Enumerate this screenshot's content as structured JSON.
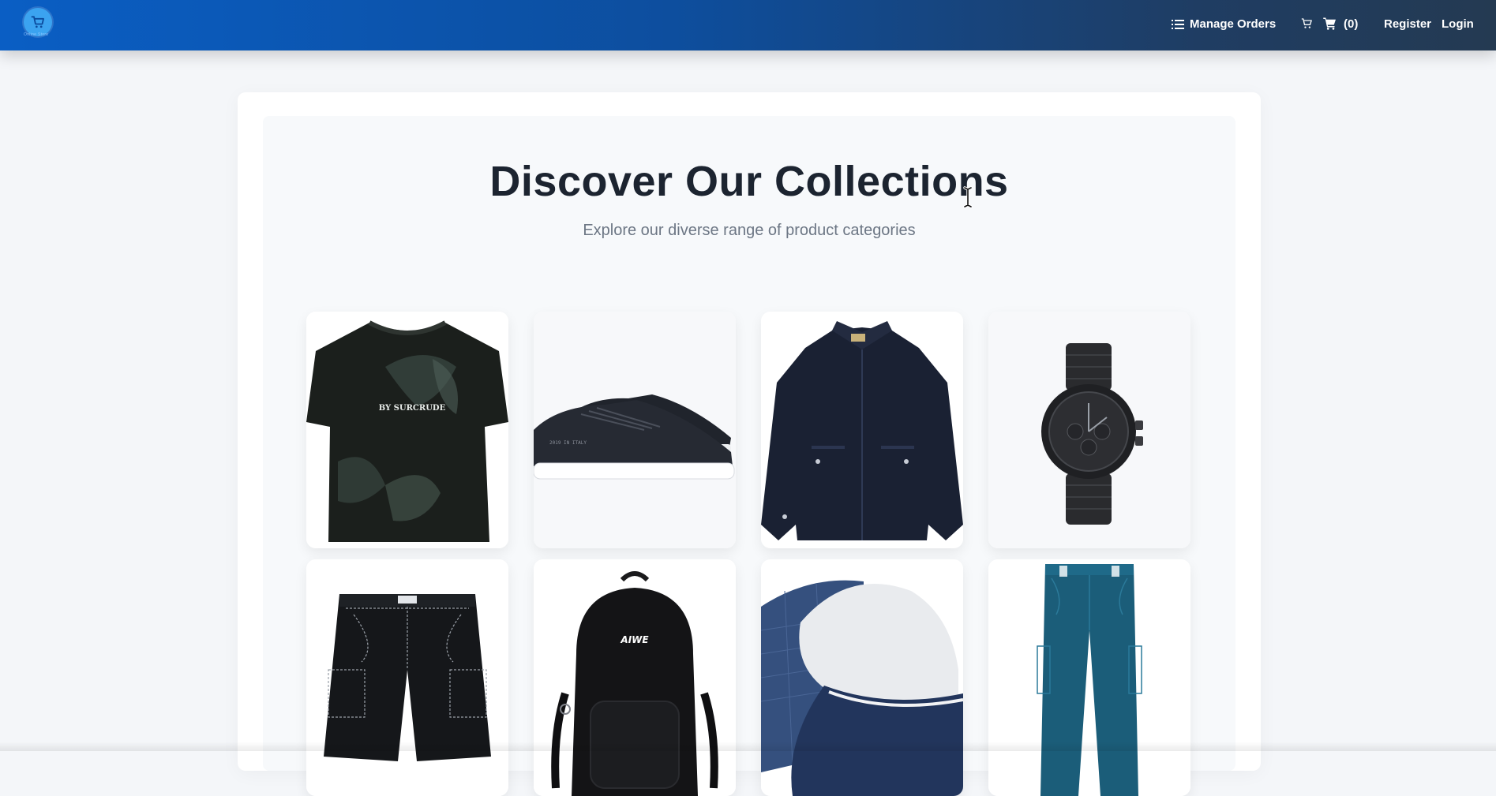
{
  "navbar": {
    "logo_text": "Online Store",
    "manage_orders_label": "Manage Orders",
    "cart_count_label": "(0)",
    "register_label": "Register",
    "login_label": "Login",
    "icons": {
      "logo": "cart-logo-icon",
      "manage_orders": "list-icon",
      "cart_outline": "cart-outline-icon",
      "cart_solid": "cart-solid-icon"
    }
  },
  "colors": {
    "navbar_start": "#0a5ec4",
    "navbar_end": "#243a52",
    "title_text": "#1c2430",
    "subtitle_text": "#6c7684"
  },
  "hero": {
    "title": "Discover Our Collections",
    "subtitle": "Explore our diverse range of product categories"
  },
  "categories": [
    {
      "image": "t-shirt",
      "print_text": "BY SURCRUDE"
    },
    {
      "image": "sneakers",
      "print_text": ""
    },
    {
      "image": "jacket",
      "print_text": ""
    },
    {
      "image": "watch",
      "print_text": ""
    },
    {
      "image": "cargo-shorts",
      "print_text": ""
    },
    {
      "image": "backpack",
      "print_text": "AIWE"
    },
    {
      "image": "trucker-cap",
      "print_text": ""
    },
    {
      "image": "pants",
      "print_text": ""
    }
  ]
}
